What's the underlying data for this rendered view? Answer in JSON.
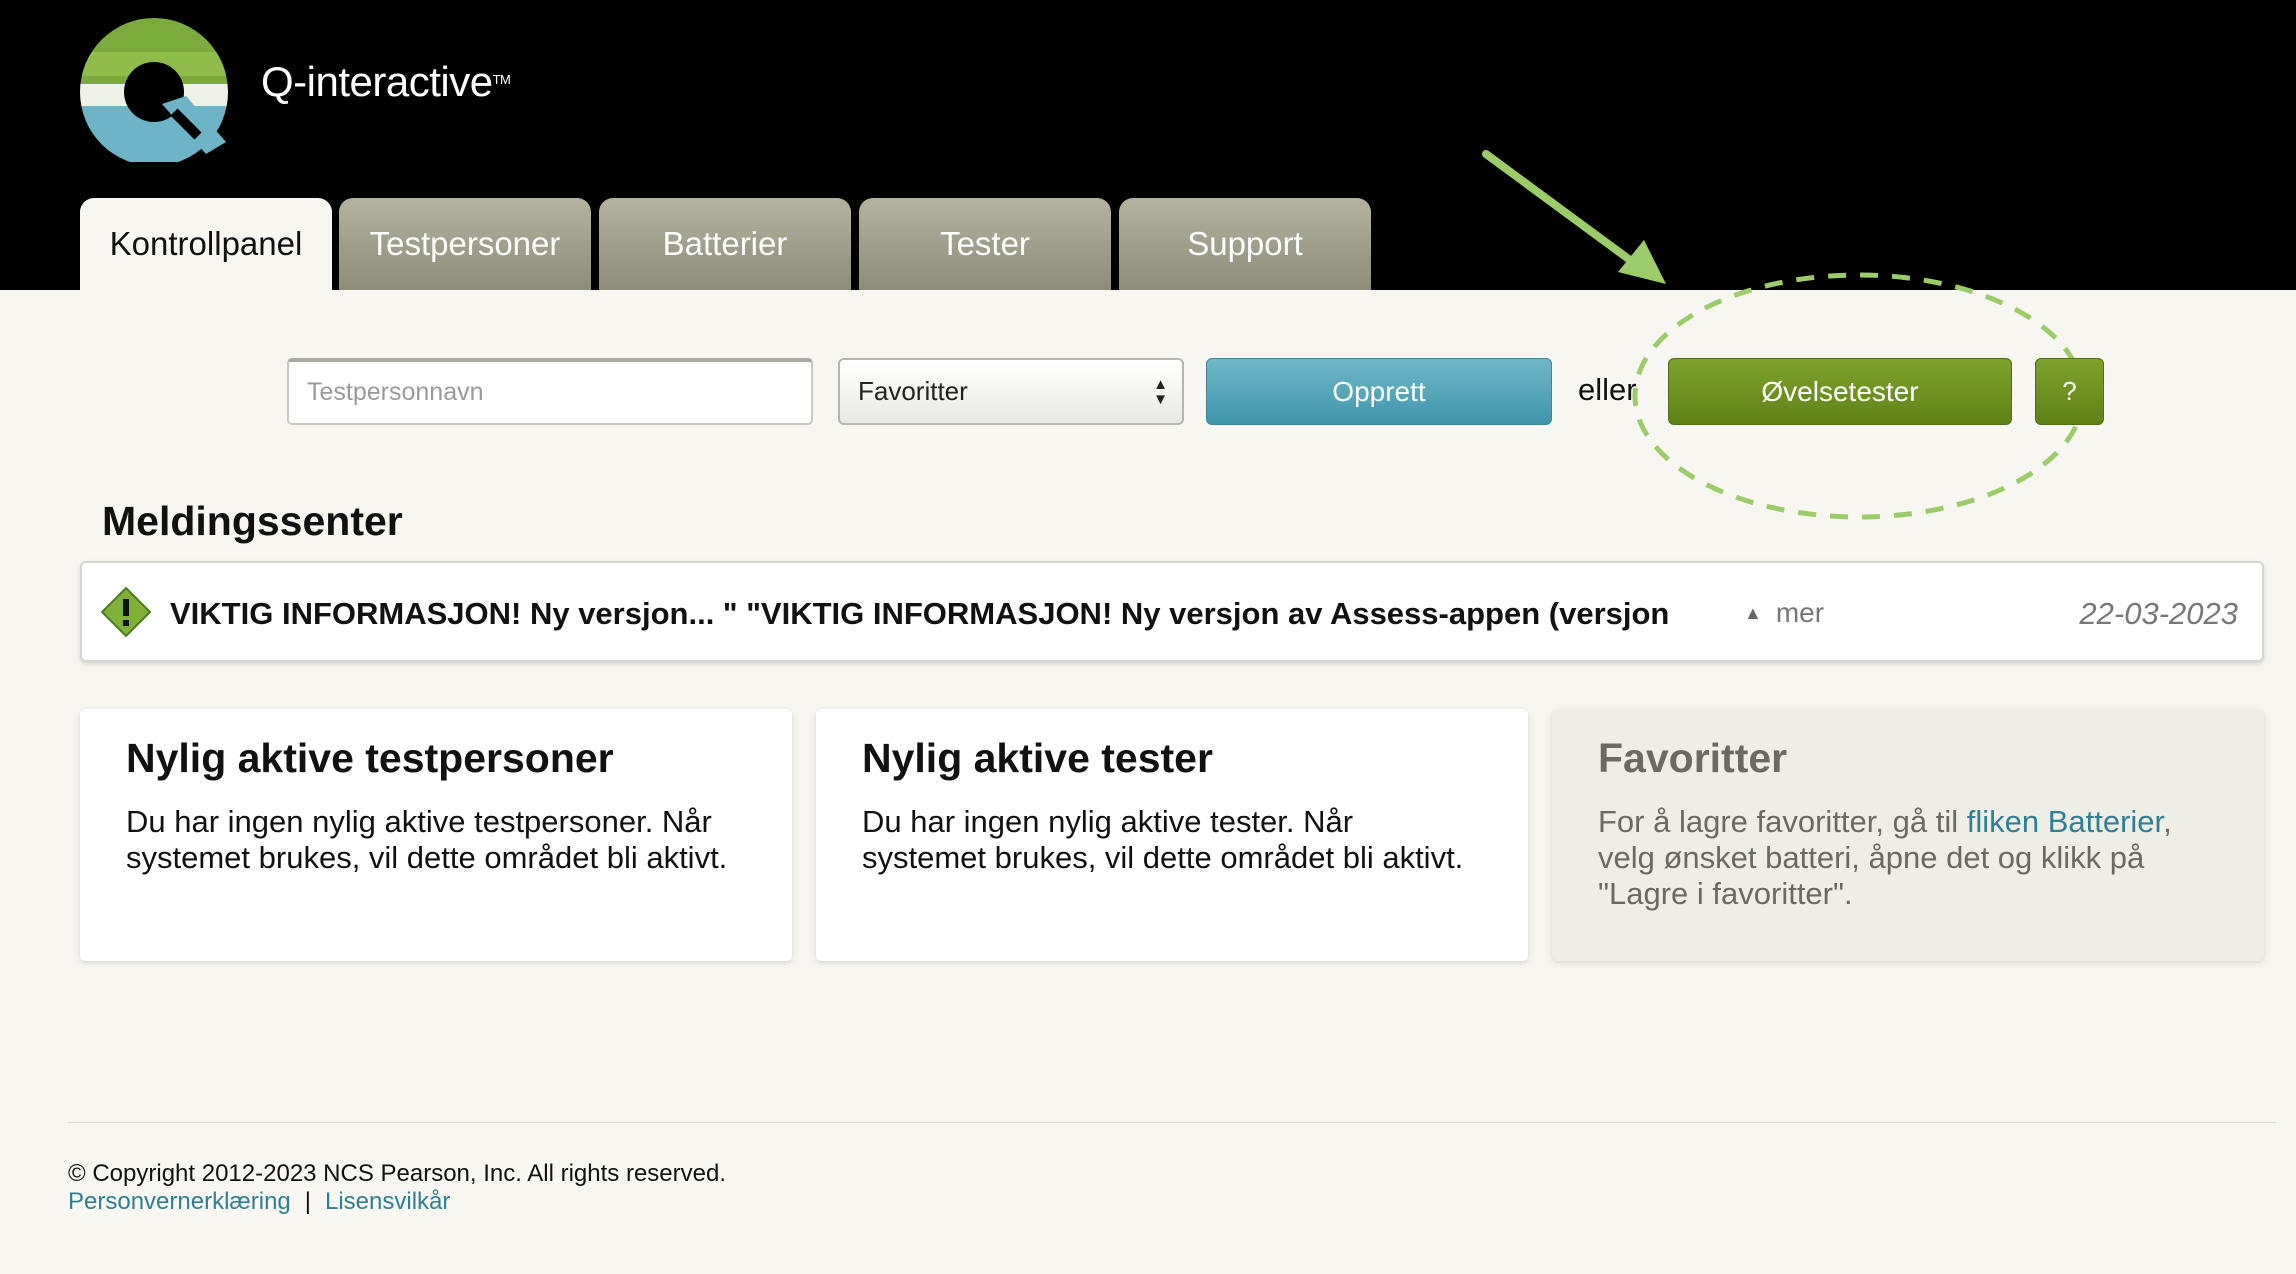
{
  "header": {
    "brand": "Q-interactive",
    "tm": "TM"
  },
  "tabs": [
    {
      "label": "Kontrollpanel",
      "active": true
    },
    {
      "label": "Testpersoner"
    },
    {
      "label": "Batterier"
    },
    {
      "label": "Tester"
    },
    {
      "label": "Support"
    }
  ],
  "toolbar": {
    "search_placeholder": "Testpersonnavn",
    "select_value": "Favoritter",
    "create_label": "Opprett",
    "or_label": "eller",
    "practice_label": "Øvelsetester",
    "help_label": "?"
  },
  "messages": {
    "heading": "Meldingssenter",
    "item": {
      "text": "VIKTIG INFORMASJON! Ny versjon... \" \"VIKTIG INFORMASJON! Ny versjon av Assess-appen (versjon",
      "more_label": "mer",
      "date": "22-03-2023"
    }
  },
  "cards": {
    "recent_persons": {
      "title": "Nylig aktive testpersoner",
      "body": "Du har ingen nylig aktive testpersoner. Når systemet brukes, vil dette området bli aktivt."
    },
    "recent_tests": {
      "title": "Nylig aktive tester",
      "body": "Du har ingen nylig aktive tester. Når systemet brukes, vil dette området bli aktivt."
    },
    "favorites": {
      "title": "Favoritter",
      "body_pre": "For å lagre favoritter, gå til ",
      "body_link": "fliken Batterier",
      "body_post": ", velg ønsket batteri, åpne det og klikk på \"Lagre i favoritter\"."
    }
  },
  "footer": {
    "copyright": "© Copyright 2012-2023 NCS Pearson, Inc. All rights reserved.",
    "privacy_label": "Personvernerklæring",
    "separator": "|",
    "license_label": "Lisensvilkår"
  },
  "colors": {
    "accent_teal": "#3f95aa",
    "accent_green": "#6b8e1f",
    "annotation_green": "#9ccc6a"
  },
  "icons": [
    "q-logo-icon",
    "warning-icon",
    "chevron-updown-icon",
    "caret-up-icon",
    "annotation-arrow-icon"
  ]
}
